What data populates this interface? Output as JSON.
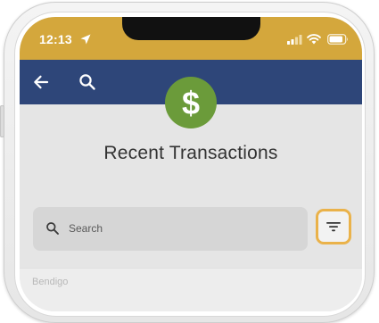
{
  "status_bar": {
    "time": "12:13",
    "background_color": "#d4a73c",
    "icons": [
      "location-arrow-icon",
      "signal-bars-icon",
      "wifi-icon",
      "battery-icon"
    ]
  },
  "header": {
    "background_color": "#2e4679",
    "back_icon": "arrow-left-icon",
    "search_icon": "search-icon"
  },
  "badge": {
    "icon": "dollar-sign-icon",
    "symbol": "$",
    "color": "#6b9b3a"
  },
  "page": {
    "title": "Recent Transactions"
  },
  "search": {
    "placeholder": "Search",
    "value": ""
  },
  "filter": {
    "icon": "filter-icon",
    "highlight_color": "#eab24a"
  },
  "list": {
    "first_row_text": "Bendigo"
  }
}
